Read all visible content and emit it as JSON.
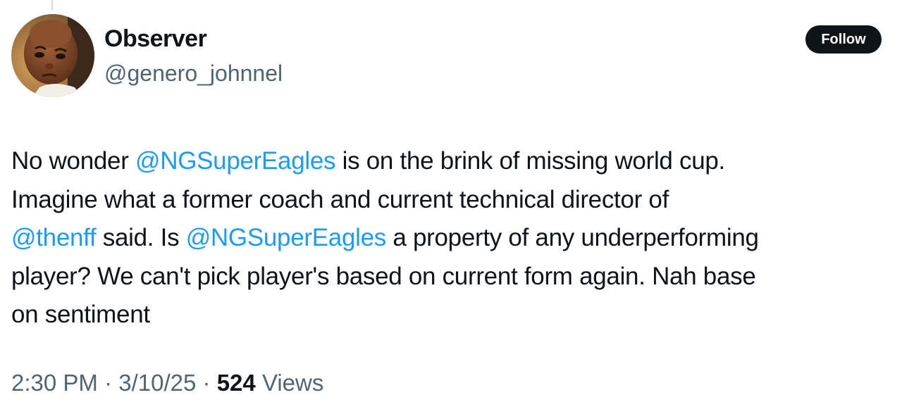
{
  "author": {
    "display_name": "Observer",
    "handle": "@genero_johnnel",
    "avatar_icon": "profile-photo-child"
  },
  "follow_label": "Follow",
  "tweet": {
    "parts": [
      {
        "text": "No wonder ",
        "type": "text"
      },
      {
        "text": "@NGSuperEagles",
        "type": "mention"
      },
      {
        "text": " is on the brink of missing world cup.",
        "type": "text"
      },
      {
        "text": "Imagine what a former coach and current technical director of",
        "type": "text"
      },
      {
        "text": "@thenff",
        "type": "mention"
      },
      {
        "text": " said. Is ",
        "type": "text"
      },
      {
        "text": "@NGSuperEagles",
        "type": "mention"
      },
      {
        "text": " a property of any underperforming",
        "type": "text"
      },
      {
        "text": "player? We can't pick player's based on current form again. Nah base",
        "type": "text"
      },
      {
        "text": "on sentiment",
        "type": "text"
      }
    ]
  },
  "meta": {
    "time": "2:30 PM",
    "separator": "·",
    "date": "3/10/25",
    "views_count": "524",
    "views_label": "Views"
  },
  "colors": {
    "mention": "#1d9bf0",
    "secondary_text": "#536471",
    "primary_text": "#0f1419",
    "follow_bg": "#0f1419"
  }
}
